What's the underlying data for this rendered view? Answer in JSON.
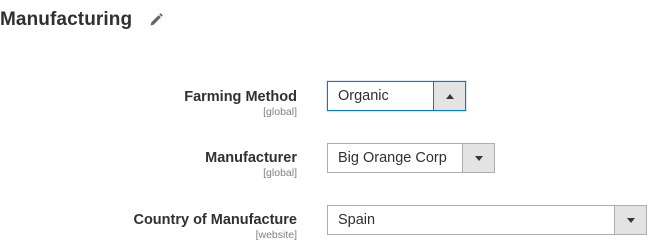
{
  "section": {
    "title": "Manufacturing",
    "edit_icon": "pencil-icon"
  },
  "fields": [
    {
      "label": "Farming Method",
      "scope": "[global]",
      "value": "Organic",
      "state": "open"
    },
    {
      "label": "Manufacturer",
      "scope": "[global]",
      "value": "Big Orange Corp",
      "state": "closed"
    },
    {
      "label": "Country of Manufacture",
      "scope": "[website]",
      "value": "Spain",
      "state": "closed"
    }
  ],
  "colors": {
    "focus_border": "#007bdb",
    "arrow_bg": "#e3e3e3",
    "border": "#adadad",
    "scope_text": "#808080"
  }
}
